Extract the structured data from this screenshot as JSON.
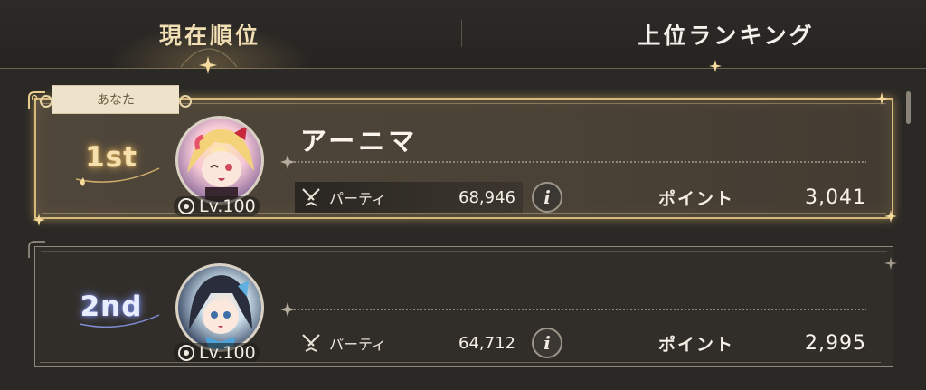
{
  "tabs": {
    "current_rank": "現在順位",
    "top_ranking": "上位ランキング"
  },
  "entries": [
    {
      "you_label": "あなた",
      "rank": "1st",
      "name": "アーニマ",
      "level": "Lv.100",
      "party_label": "パーティ",
      "party_value": "68,946",
      "info_label": "i",
      "points_label": "ポイント",
      "points_value": "3,041"
    },
    {
      "rank": "2nd",
      "name": "",
      "level": "Lv.100",
      "party_label": "パーティ",
      "party_value": "64,712",
      "info_label": "i",
      "points_label": "ポイント",
      "points_value": "2,995"
    }
  ],
  "colors": {
    "accent_gold": "#d7b97a",
    "background": "#2b2926",
    "rank1_glow": "#f0be64",
    "rank2_glow": "#8ca0ff"
  }
}
